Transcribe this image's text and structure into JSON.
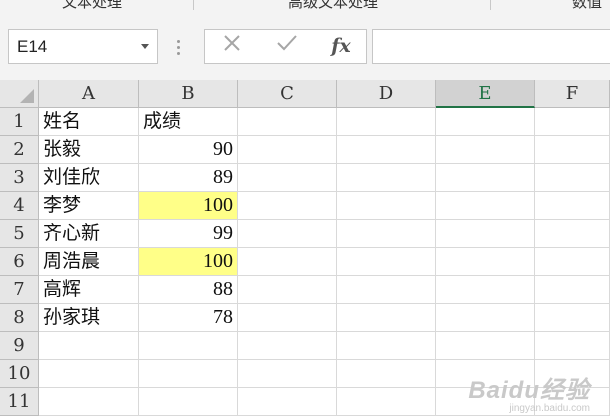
{
  "ribbon": {
    "groups": [
      "文本处理",
      "高级文本处理",
      "数值"
    ]
  },
  "formula_bar": {
    "name_box": "E14",
    "cancel_icon": "cancel-x-icon",
    "enter_icon": "checkmark-icon",
    "fx_label": "fx",
    "formula_value": ""
  },
  "sheet": {
    "columns": [
      "A",
      "B",
      "C",
      "D",
      "E",
      "F"
    ],
    "active_column": "E",
    "rows": [
      "1",
      "2",
      "3",
      "4",
      "5",
      "6",
      "7",
      "8",
      "9",
      "10",
      "11"
    ],
    "data": [
      {
        "name": "姓名",
        "score": "成绩"
      },
      {
        "name": "张毅",
        "score": "90"
      },
      {
        "name": "刘佳欣",
        "score": "89"
      },
      {
        "name": "李梦",
        "score": "100"
      },
      {
        "name": "齐心新",
        "score": "99"
      },
      {
        "name": "周浩晨",
        "score": "100"
      },
      {
        "name": "高辉",
        "score": "88"
      },
      {
        "name": "孙家琪",
        "score": "78"
      }
    ],
    "highlight_color": "#ffff88",
    "accent_color": "#217346"
  },
  "watermark": {
    "main": "Baidu经验",
    "sub": "jingyan.baidu.com"
  }
}
